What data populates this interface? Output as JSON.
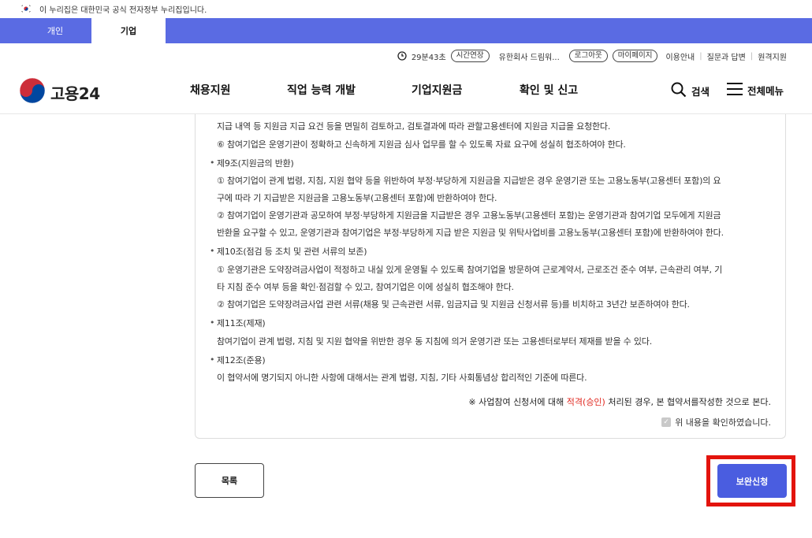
{
  "gov_banner": {
    "text": "이 누리집은 대한민국 공식 전자정부 누리집입니다."
  },
  "tabs": [
    {
      "label": "개인"
    },
    {
      "label": "기업"
    }
  ],
  "util": {
    "timer": "29분43초",
    "extend": "시간연장",
    "user": "유한회사 드림워...",
    "logout": "로그아웃",
    "mypage": "마이페이지",
    "guide": "이용안내",
    "faq": "질문과 답변",
    "remote": "원격지원"
  },
  "logo": {
    "text": "고용24"
  },
  "gnb": [
    {
      "label": "채용지원"
    },
    {
      "label": "직업 능력 개발"
    },
    {
      "label": "기업지원금"
    },
    {
      "label": "확인 및 신고"
    }
  ],
  "search": "검색",
  "allmenu": "전체메뉴",
  "terms": [
    "지급 내역 등 지원금 지급 요건 등을 면밀히 검토하고, 검토결과에 따라 관할고용센터에 지원금 지급을 요청한다.",
    "⑥ 참여기업은 운영기관이 정확하고 신속하게 지원금 심사 업무를 할 수 있도록 자료 요구에 성실히 협조하여야 한다.",
    "제9조(지원금의 반환)",
    "① 참여기업이 관계 법령, 지침, 지원 협약 등을 위반하여 부정·부당하게 지원금을 지급받은 경우 운영기관 또는 고용노동부(고용센터 포함)의 요",
    "구에 따라 기 지급받은 지원금을 고용노동부(고용센터 포함)에 반환하여야 한다.",
    "② 참여기업이 운영기관과 공모하여 부정·부당하게 지원금을 지급받은 경우 고용노동부(고용센터 포함)는 운영기관과 참여기업 모두에게 지원금",
    "반환을 요구할 수 있고, 운영기관과 참여기업은 부정·부당하게 지급 받은 지원금 및 위탁사업비를 고용노동부(고용센터 포함)에 반환하여야 한다.",
    "제10조(점검 등 조치 및 관련 서류의 보존)",
    "① 운영기관은 도약장려금사업이 적정하고 내실 있게 운영될 수 있도록 참여기업을 방문하여 근로계약서, 근로조건 준수 여부, 근속관리 여부, 기",
    "타 지침 준수 여부 등을 확인·점검할 수 있고, 참여기업은 이에 성실히 협조해야 한다.",
    "② 참여기업은 도약장려금사업 관련 서류(채용 및 근속관련 서류, 임금지급 및 지원금 신청서류 등)를 비치하고 3년간 보존하여야 한다.",
    "제11조(제재)",
    "참여기업이 관계 법령, 지침 및 지원 협약을 위반한 경우 동 지침에 의거 운영기관 또는 고용센터로부터 제재를 받을 수 있다.",
    "제12조(준용)",
    "이 협약서에 명기되지 아니한 사항에 대해서는 관계 법령, 지침, 기타 사회통념상 합리적인 기준에 따른다."
  ],
  "notice": {
    "prefix": "※ 사업참여 신청서에 대해 ",
    "red": "적격(승인)",
    "suffix": " 처리된 경우, 본 협약서를작성한 것으로 본다."
  },
  "confirm": {
    "label": "위 내용을 확인하였습니다."
  },
  "buttons": {
    "list": "목록",
    "submit": "보완신청"
  },
  "colors": {
    "primary": "#5a6be3",
    "highlight": "#e3140d",
    "accent_red": "#e0271f"
  }
}
